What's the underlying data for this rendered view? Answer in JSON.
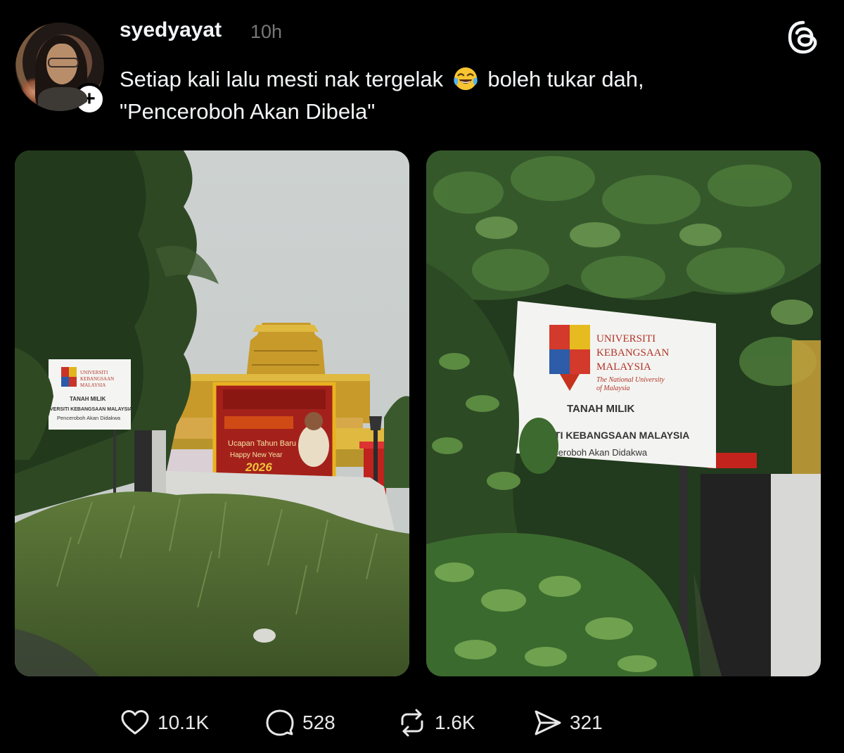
{
  "post": {
    "username": "syedyayat",
    "timestamp": "10h",
    "caption_part1": "Setiap kali lalu mesti nak tergelak",
    "caption_emoji": "face-with-tears-of-joy",
    "caption_part2": "boleh tukar dah,",
    "caption_line2": "\"Penceroboh Akan Dibela\"",
    "follow_symbol": "+"
  },
  "images": {
    "left": {
      "sign_lines": [
        "UNIVERSITI",
        "KEBANGSAAN",
        "MALAYSIA",
        "TANAH MILIK",
        "VERSITI KEBANGSAAN MALAYSIA",
        "Penceroboh Akan Didakwa"
      ],
      "banner_line1": "Ucapan Tahun Baru",
      "banner_line2": "Happy New Year",
      "banner_year": "2026"
    },
    "right": {
      "sign_brand_1": "UNIVERSITI",
      "sign_brand_2": "KEBANGSAAN",
      "sign_brand_3": "MALAYSIA",
      "sign_tagline_1": "The National University",
      "sign_tagline_2": "of Malaysia",
      "sign_title": "TANAH MILIK",
      "sign_org": "VERSITI KEBANGSAAN MALAYSIA",
      "sign_warning": "Penceroboh Akan Didakwa"
    }
  },
  "actions": {
    "likes": "10.1K",
    "replies": "528",
    "reposts": "1.6K",
    "shares": "321"
  },
  "colors": {
    "background": "#000000",
    "text": "#f3f5f7",
    "muted": "#777777"
  }
}
